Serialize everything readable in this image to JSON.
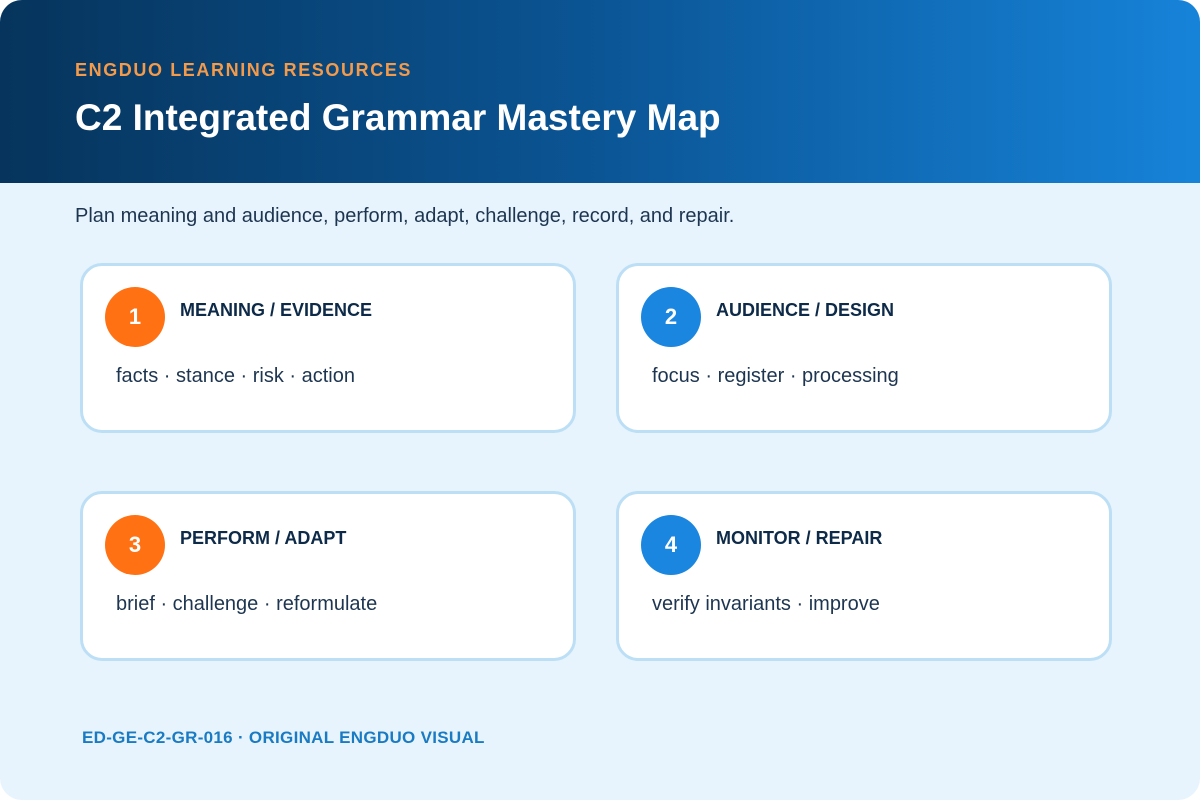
{
  "header": {
    "eyebrow": "ENGDUO LEARNING RESOURCES",
    "title": "C2 Integrated Grammar Mastery Map"
  },
  "subtitle": "Plan meaning and audience, perform, adapt, challenge, record, and repair.",
  "cards": [
    {
      "number": "1",
      "title": "MEANING / EVIDENCE",
      "body": "facts · stance · risk · action",
      "badge_color": "#ff7112"
    },
    {
      "number": "2",
      "title": "AUDIENCE / DESIGN",
      "body": "focus · register · processing",
      "badge_color": "#1a86e0"
    },
    {
      "number": "3",
      "title": "PERFORM / ADAPT",
      "body": "brief · challenge · reformulate",
      "badge_color": "#ff7112"
    },
    {
      "number": "4",
      "title": "MONITOR / REPAIR",
      "body": "verify invariants · improve",
      "badge_color": "#1a86e0"
    }
  ],
  "footer": "ED-GE-C2-GR-016 · ORIGINAL ENGDUO VISUAL",
  "colors": {
    "header_dark": "#06345c",
    "header_light": "#1683d9",
    "accent_orange": "#f39a4b",
    "background": "#e7f4fd",
    "card_border": "#bcdff5",
    "footer_text": "#1a7bc3"
  }
}
